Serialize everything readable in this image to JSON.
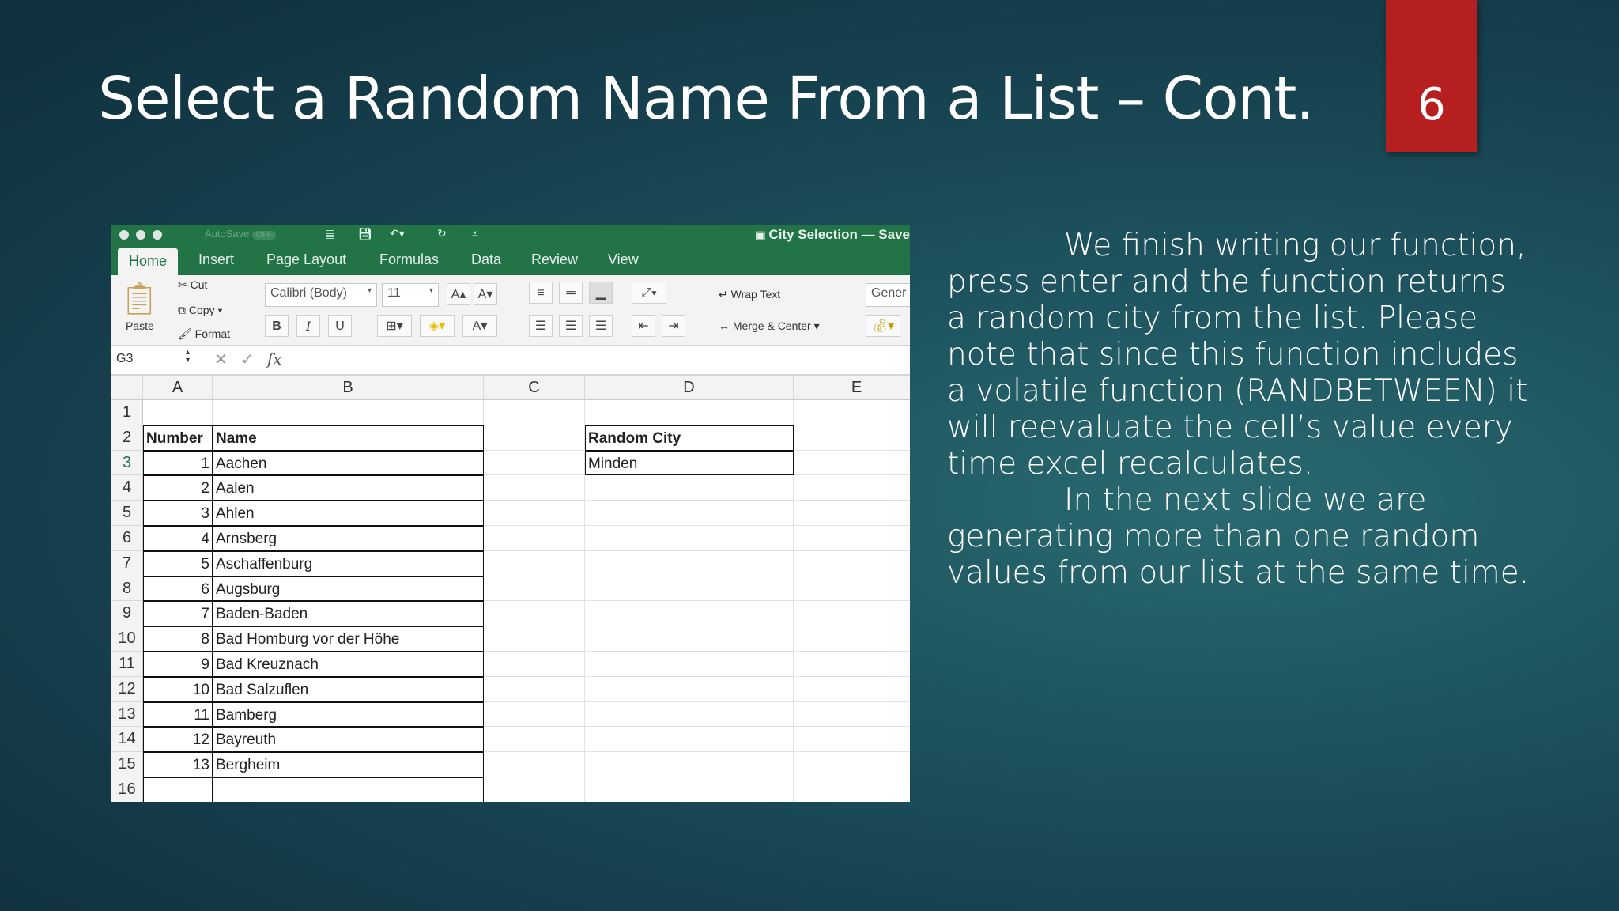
{
  "slide": {
    "title": "Select a Random Name From a List – Cont.",
    "page_number": "6",
    "paragraph1": "We finish writing our function, press enter and the function returns a random city from the list. Please note that since this function includes a volatile function (RANDBETWEEN) it will reevaluate the cell’s value every time excel recalculates.",
    "paragraph2": "In the next slide we are generating more than one random values from our list at the same time."
  },
  "excel": {
    "autosave": "AutoSave",
    "autosave_state": "OFF",
    "document_title": "City Selection — Save",
    "tabs": [
      "Home",
      "Insert",
      "Page Layout",
      "Formulas",
      "Data",
      "Review",
      "View"
    ],
    "ribbon": {
      "paste": "Paste",
      "cut": "Cut",
      "copy": "Copy",
      "format": "Format",
      "font": "Calibri (Body)",
      "font_size": "11",
      "bold": "B",
      "italic": "I",
      "underline": "U",
      "wrap_text": "Wrap Text",
      "merge_center": "Merge & Center",
      "number_format": "Gener"
    },
    "name_box": "G3",
    "fx": "fx",
    "columns": [
      "A",
      "B",
      "C",
      "D",
      "E"
    ],
    "rows": [
      "1",
      "2",
      "3",
      "4",
      "5",
      "6",
      "7",
      "8",
      "9",
      "10",
      "11",
      "12",
      "13",
      "14",
      "15",
      "16"
    ],
    "table_header": {
      "number": "Number",
      "name": "Name"
    },
    "table": [
      {
        "n": "1",
        "name": "Aachen"
      },
      {
        "n": "2",
        "name": "Aalen"
      },
      {
        "n": "3",
        "name": "Ahlen"
      },
      {
        "n": "4",
        "name": "Arnsberg"
      },
      {
        "n": "5",
        "name": "Aschaffenburg"
      },
      {
        "n": "6",
        "name": "Augsburg"
      },
      {
        "n": "7",
        "name": "Baden-Baden"
      },
      {
        "n": "8",
        "name": "Bad Homburg vor der Höhe"
      },
      {
        "n": "9",
        "name": "Bad Kreuznach"
      },
      {
        "n": "10",
        "name": "Bad Salzuflen"
      },
      {
        "n": "11",
        "name": "Bamberg"
      },
      {
        "n": "12",
        "name": "Bayreuth"
      },
      {
        "n": "13",
        "name": "Bergheim"
      }
    ],
    "random_city_label": "Random City",
    "random_city_value": "Minden",
    "colors": {
      "excel_green": "#227447",
      "slide_badge": "#b51f1f"
    }
  }
}
